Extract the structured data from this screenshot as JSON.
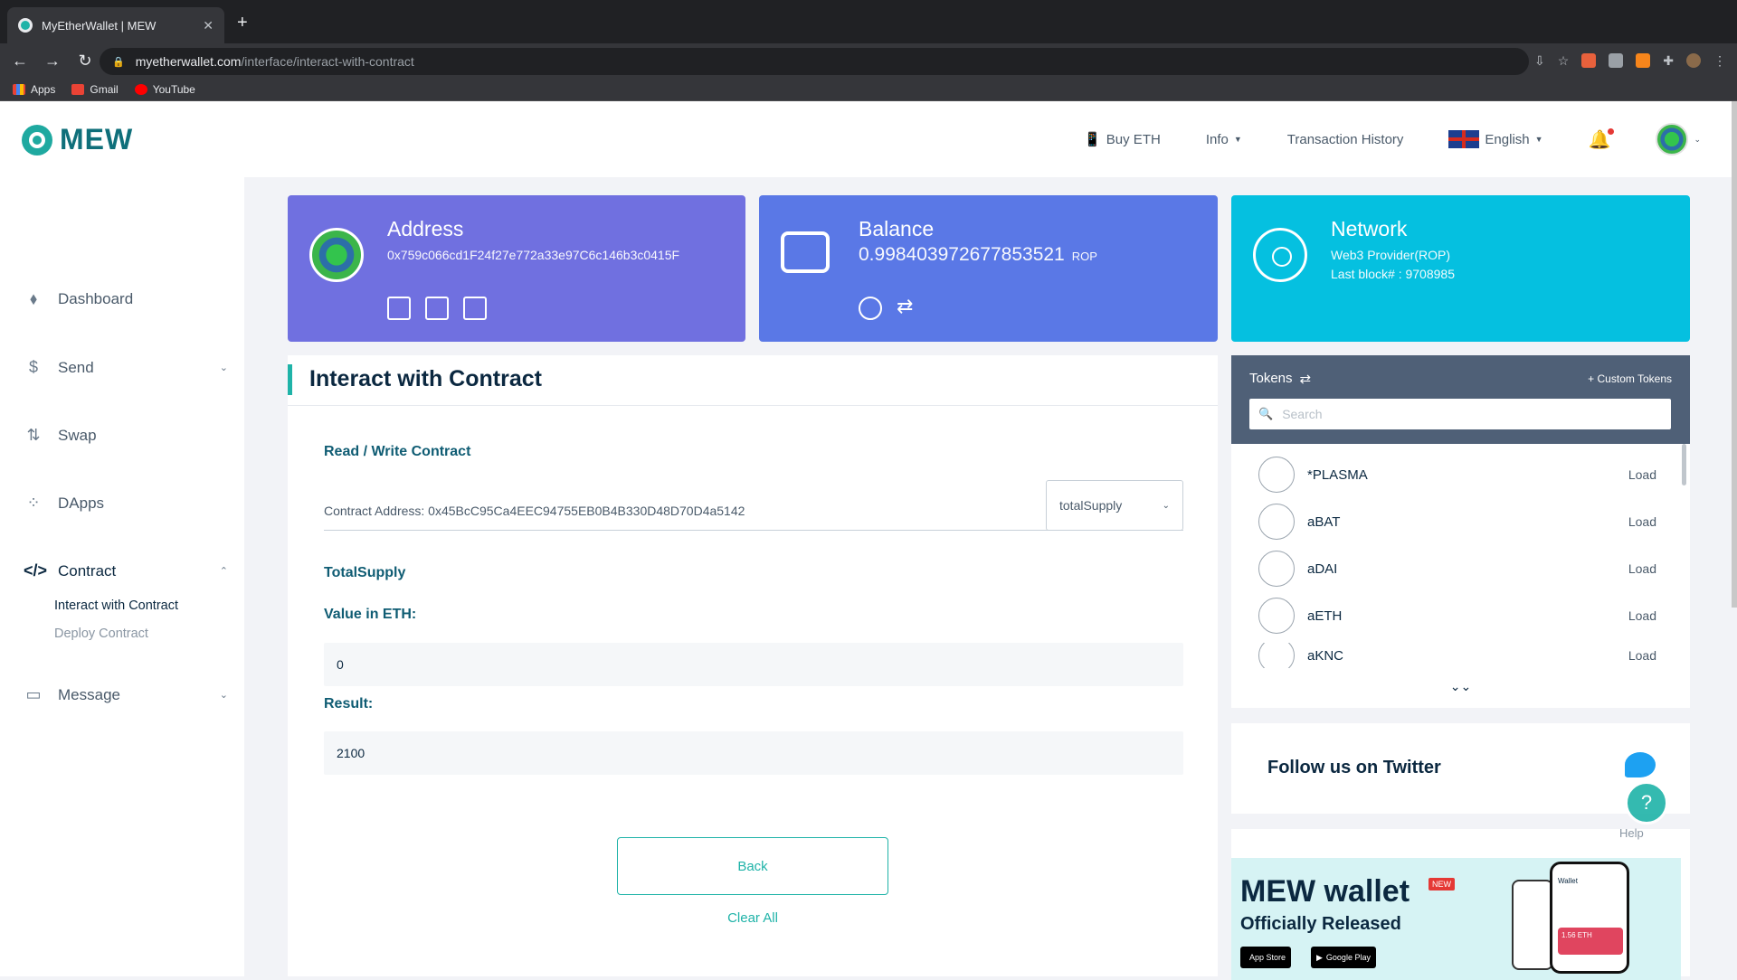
{
  "browser": {
    "tab_title": "MyEtherWallet | MEW",
    "tab_close": "✕",
    "new_tab": "+",
    "url_host": "myetherwallet.com",
    "url_path": "/interface/interact-with-contract",
    "bookmarks": [
      "Apps",
      "Gmail",
      "YouTube"
    ]
  },
  "header": {
    "logo_text": "MEW",
    "buy_eth": "Buy ETH",
    "info": "Info",
    "tx_history": "Transaction History",
    "language": "English"
  },
  "sidebar": {
    "items": [
      {
        "label": "Dashboard",
        "icon": "ethereum-icon"
      },
      {
        "label": "Send",
        "icon": "send-icon"
      },
      {
        "label": "Swap",
        "icon": "swap-icon"
      },
      {
        "label": "DApps",
        "icon": "dapps-icon"
      },
      {
        "label": "Contract",
        "icon": "code-icon"
      },
      {
        "label": "Message",
        "icon": "message-icon"
      }
    ],
    "contract_sub": [
      "Interact with Contract",
      "Deploy Contract"
    ]
  },
  "cards": {
    "address": {
      "title": "Address",
      "value": "0x759c066cd1F24f27e772a33e97C6c146b3c0415F"
    },
    "balance": {
      "title": "Balance",
      "value": "0.998403972677853521",
      "unit": "ROP"
    },
    "network": {
      "title": "Network",
      "provider": "Web3 Provider(ROP)",
      "last_block": "Last block# : 9708985"
    }
  },
  "main": {
    "title": "Interact with Contract",
    "section": "Read / Write Contract",
    "contract_address": "Contract Address: 0x45BcC95Ca4EEC94755EB0B4B330D48D70D4a5142",
    "function_selected": "totalSupply",
    "fn_title": "TotalSupply",
    "value_label": "Value in ETH:",
    "value": "0",
    "result_label": "Result:",
    "result": "2100",
    "back": "Back",
    "clear_all": "Clear All"
  },
  "tokens": {
    "title": "Tokens",
    "custom": "+ Custom Tokens",
    "search_placeholder": "Search",
    "load_label": "Load",
    "list": [
      "*PLASMA",
      "aBAT",
      "aDAI",
      "aETH",
      "aKNC"
    ]
  },
  "twitter": {
    "text": "Follow us on Twitter"
  },
  "promo": {
    "title": "MEW wallet",
    "badge": "NEW",
    "subtitle": "Officially Released",
    "app_store": "App Store",
    "google_play": "Google Play",
    "phone_wallet": "Wallet",
    "phone_balance": "1.56 ETH"
  },
  "help": {
    "label": "Help"
  },
  "colors": {
    "accent": "#1fb3a8",
    "address_card": "#7070e0",
    "balance_card": "#5a78e6",
    "network_card": "#05c0e0"
  }
}
